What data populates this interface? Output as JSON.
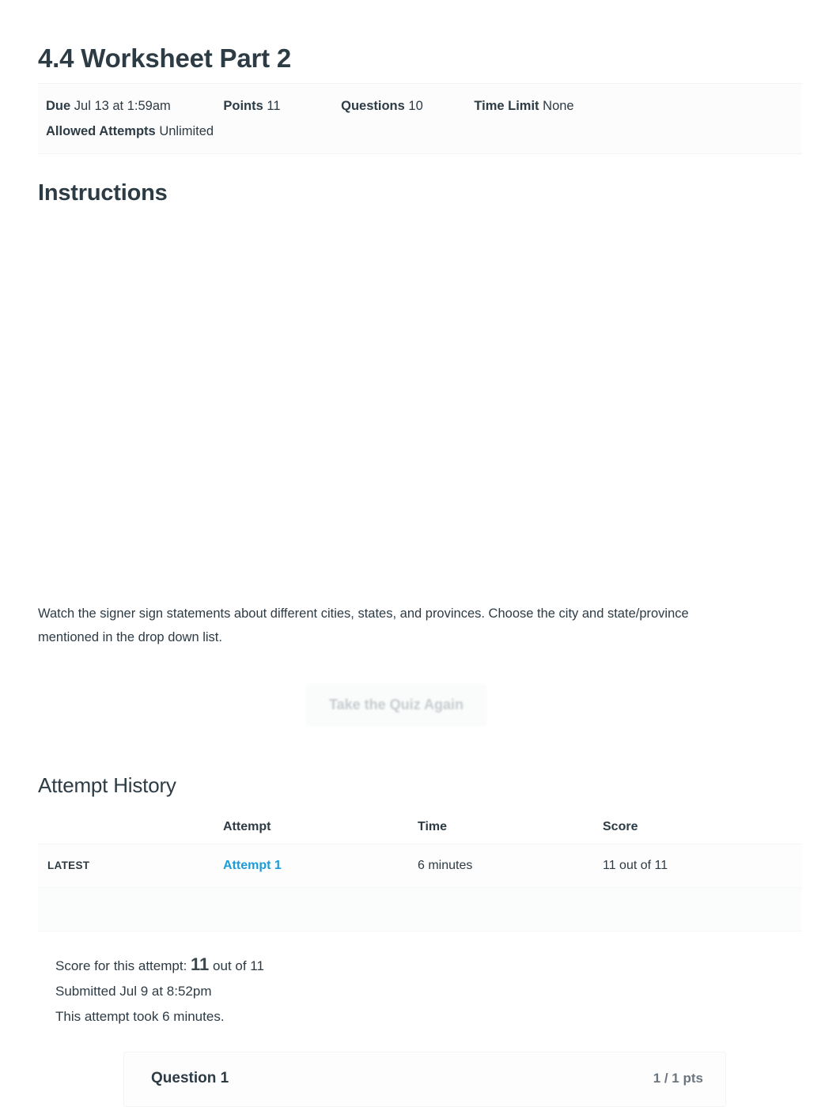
{
  "quiz": {
    "title": "4.4 Worksheet Part 2",
    "meta": {
      "due_label": "Due",
      "due_value": "Jul 13 at 1:59am",
      "points_label": "Points",
      "points_value": "11",
      "questions_label": "Questions",
      "questions_value": "10",
      "time_limit_label": "Time Limit",
      "time_limit_value": "None",
      "allowed_attempts_label": "Allowed Attempts",
      "allowed_attempts_value": "Unlimited"
    }
  },
  "instructions": {
    "heading": "Instructions",
    "text": "Watch the signer sign statements about different cities, states, and provinces. Choose the city and state/province mentioned in the drop down list."
  },
  "actions": {
    "retake_label": "Take the Quiz Again"
  },
  "attempt_history": {
    "heading": "Attempt History",
    "columns": [
      "",
      "Attempt",
      "Time",
      "Score"
    ],
    "rows": [
      {
        "kept": "LATEST",
        "attempt": "Attempt 1",
        "time": "6 minutes",
        "score": "11 out of 11"
      }
    ]
  },
  "score_summary": {
    "score_prefix": "Score for this attempt:",
    "score_value": "11",
    "score_suffix": "out of 11",
    "submitted": "Submitted Jul 9 at 8:52pm",
    "duration": "This attempt took 6 minutes."
  },
  "questions": [
    {
      "title": "Question 1",
      "points": "1 / 1 pts"
    }
  ],
  "colors": {
    "link_blue": "#1c9bd8",
    "text": "#2d3b45",
    "muted": "#6b7780",
    "row_bg": "#fdfdfe"
  }
}
